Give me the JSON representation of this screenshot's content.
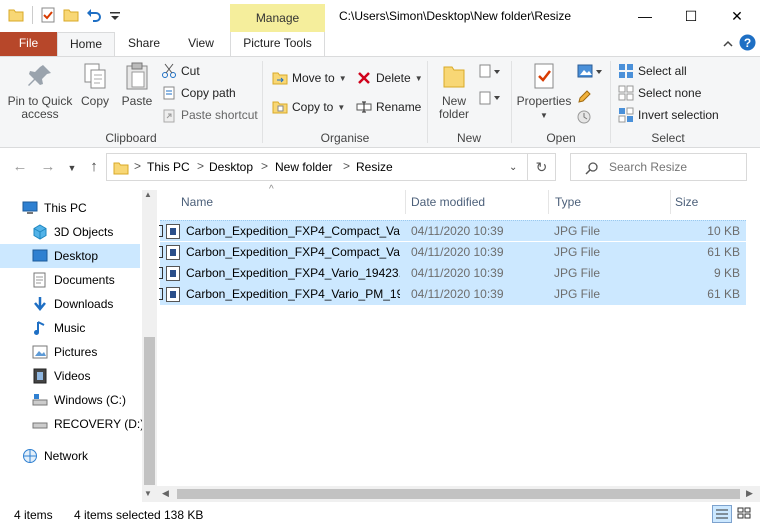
{
  "window": {
    "title": "C:\\Users\\Simon\\Desktop\\New folder\\Resize",
    "context_tab": "Manage",
    "minimize_glyph": "—",
    "maximize_glyph": "☐",
    "close_glyph": "✕"
  },
  "ribbon_tabs": {
    "file": "File",
    "home": "Home",
    "share": "Share",
    "view": "View",
    "picture_tools": "Picture Tools"
  },
  "ribbon": {
    "clipboard": {
      "label": "Clipboard",
      "pin_line1": "Pin to Quick",
      "pin_line2": "access",
      "copy": "Copy",
      "paste": "Paste",
      "cut": "Cut",
      "copy_path": "Copy path",
      "paste_shortcut": "Paste shortcut"
    },
    "organise": {
      "label": "Organise",
      "move_to": "Move to",
      "copy_to": "Copy to",
      "delete": "Delete",
      "rename": "Rename"
    },
    "new": {
      "label": "New",
      "new_folder_line1": "New",
      "new_folder_line2": "folder"
    },
    "open": {
      "label": "Open",
      "properties": "Properties"
    },
    "select": {
      "label": "Select",
      "select_all": "Select all",
      "select_none": "Select none",
      "invert_selection": "Invert selection"
    }
  },
  "address": {
    "crumbs": [
      "This PC",
      "Desktop",
      "New folder",
      "Resize"
    ],
    "separator": ">",
    "search_placeholder": "Search Resize"
  },
  "nav_pane": {
    "items": [
      {
        "label": "This PC",
        "icon": "pc-icon"
      },
      {
        "label": "3D Objects",
        "icon": "3d-objects-icon"
      },
      {
        "label": "Desktop",
        "icon": "desktop-icon"
      },
      {
        "label": "Documents",
        "icon": "documents-icon"
      },
      {
        "label": "Downloads",
        "icon": "downloads-icon"
      },
      {
        "label": "Music",
        "icon": "music-icon"
      },
      {
        "label": "Pictures",
        "icon": "pictures-icon"
      },
      {
        "label": "Videos",
        "icon": "videos-icon"
      },
      {
        "label": "Windows (C:)",
        "icon": "drive-icon"
      },
      {
        "label": "RECOVERY (D:)",
        "icon": "drive-icon"
      },
      {
        "label": "Network",
        "icon": "network-icon"
      }
    ],
    "selected": "Desktop"
  },
  "file_list": {
    "columns": {
      "name": "Name",
      "date": "Date modified",
      "type": "Type",
      "size": "Size"
    },
    "rows": [
      {
        "name": "Carbon_Expedition_FXP4_Compact_Va...",
        "date": "04/11/2020 10:39",
        "type": "JPG File",
        "size": "10 KB"
      },
      {
        "name": "Carbon_Expedition_FXP4_Compact_Va...",
        "date": "04/11/2020 10:39",
        "type": "JPG File",
        "size": "61 KB"
      },
      {
        "name": "Carbon_Expedition_FXP4_Vario_19423...",
        "date": "04/11/2020 10:39",
        "type": "JPG File",
        "size": "9 KB"
      },
      {
        "name": "Carbon_Expedition_FXP4_Vario_PM_19...",
        "date": "04/11/2020 10:39",
        "type": "JPG File",
        "size": "61 KB"
      }
    ]
  },
  "status": {
    "item_count": "4 items",
    "selected": "4 items selected",
    "size": "138 KB"
  },
  "colors": {
    "file_tab": "#b7472a",
    "manage_tab": "#f5ee9c",
    "selection": "#cce8ff",
    "ribbon_bg": "#f5f6f7"
  }
}
